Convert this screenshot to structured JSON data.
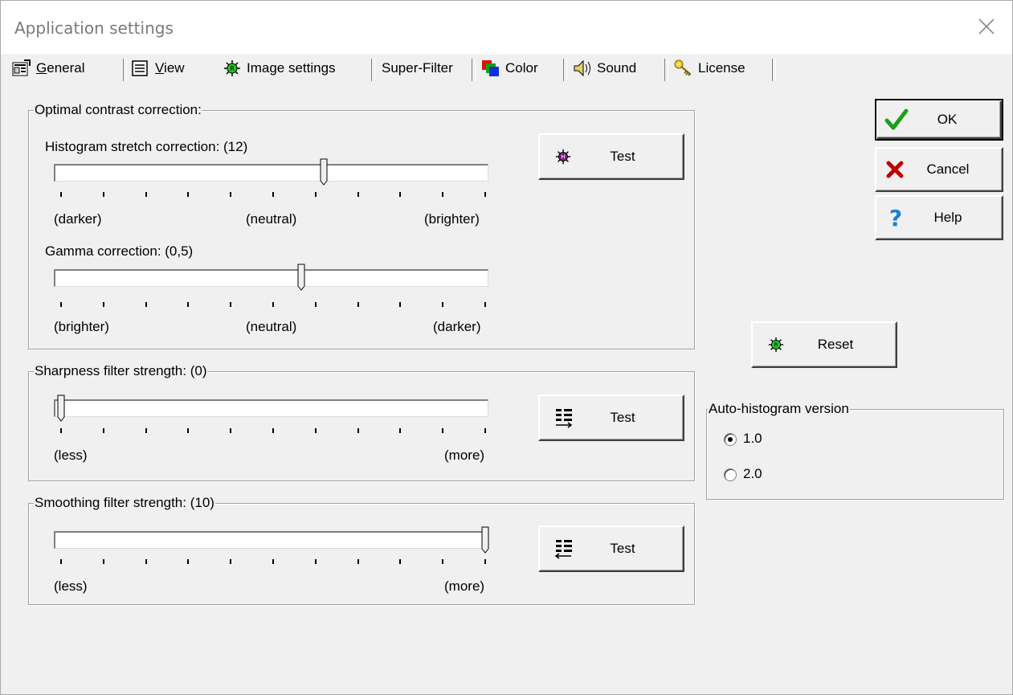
{
  "window": {
    "title": "Application settings"
  },
  "tabs": [
    {
      "label_pre": "",
      "label_u": "G",
      "label_post": "eneral",
      "icon": "properties-icon"
    },
    {
      "label_pre": "",
      "label_u": "V",
      "label_post": "iew",
      "icon": "document-icon"
    },
    {
      "label_pre": "Image settings",
      "label_u": "",
      "label_post": "",
      "icon": "virus-green-icon"
    },
    {
      "label_pre": "Super-Filter",
      "label_u": "",
      "label_post": "",
      "icon": ""
    },
    {
      "label_pre": "Color",
      "label_u": "",
      "label_post": "",
      "icon": "color-squares-icon"
    },
    {
      "label_pre": "Sound",
      "label_u": "",
      "label_post": "",
      "icon": "speaker-icon"
    },
    {
      "label_pre": "License",
      "label_u": "",
      "label_post": "",
      "icon": "keys-icon"
    }
  ],
  "optimal_contrast": {
    "title": "Optimal contrast correction:",
    "histogram": {
      "label": "Histogram stretch correction: (12)",
      "value": 0.62,
      "left": "(darker)",
      "center": "(neutral)",
      "right": "(brighter)"
    },
    "gamma": {
      "label": "Gamma correction: (0,5)",
      "value": 0.56,
      "left": "(brighter)",
      "center": "(neutral)",
      "right": "(darker)"
    },
    "test_label": "Test"
  },
  "sharpness": {
    "title": "Sharpness filter strength: (0)",
    "value": 0.0,
    "left": "(less)",
    "right": "(more)",
    "test_label": "Test"
  },
  "smoothing": {
    "title": "Smoothing filter strength: (10)",
    "value": 1.0,
    "left": "(less)",
    "right": "(more)",
    "test_label": "Test"
  },
  "buttons": {
    "ok": "OK",
    "cancel": "Cancel",
    "help": "Help",
    "reset": "Reset"
  },
  "auto_histogram": {
    "title": "Auto-histogram version",
    "options": [
      {
        "label": "1.0",
        "selected": true
      },
      {
        "label": "2.0",
        "selected": false
      }
    ]
  },
  "colors": {
    "ok_check": "#1aa01a",
    "cancel_x": "#c00000",
    "help_q": "#1a7fd6",
    "virus_green": "#22cc22",
    "virus_purple": "#7a1a7a"
  }
}
